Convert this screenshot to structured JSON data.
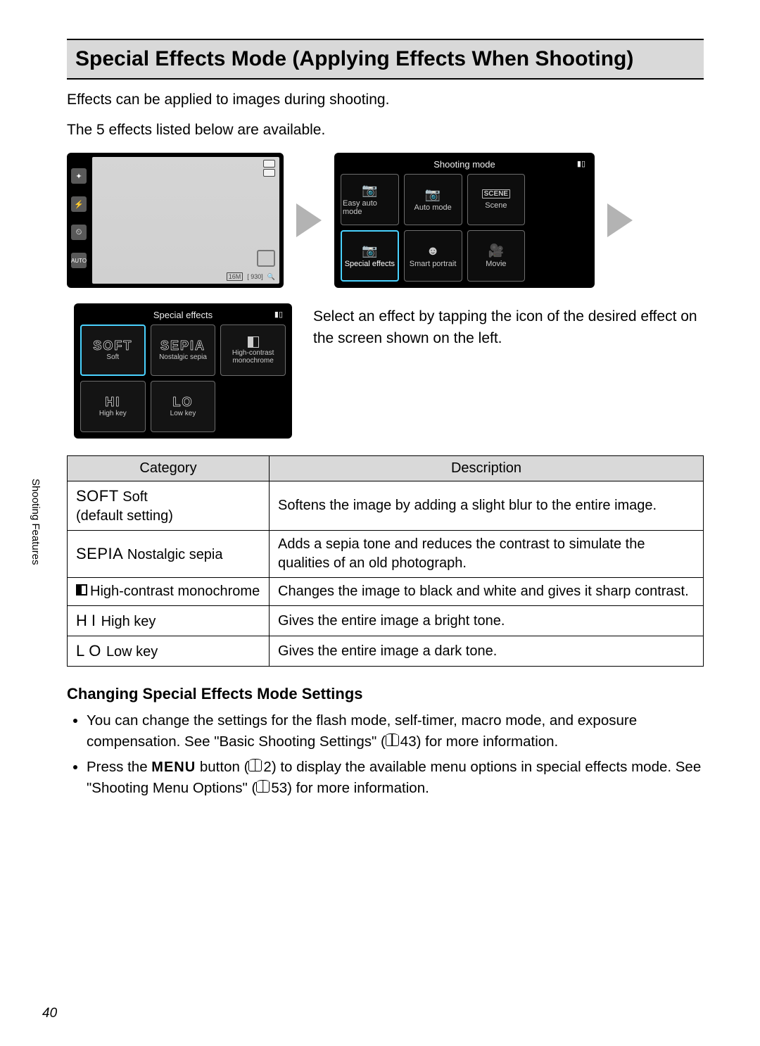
{
  "title": "Special Effects Mode (Applying Effects When Shooting)",
  "intro": {
    "line1": "Effects can be applied to images during shooting.",
    "line2": "The 5 effects listed below are available."
  },
  "screen1": {
    "badge_16m": "16M",
    "badge_count": "930"
  },
  "screen2": {
    "title": "Shooting mode",
    "cells": [
      {
        "label": "Easy auto mode"
      },
      {
        "label": "Auto mode"
      },
      {
        "label": "Scene"
      },
      {
        "label": "Special effects"
      },
      {
        "label": "Smart portrait"
      },
      {
        "label": "Movie"
      }
    ]
  },
  "screen3": {
    "title": "Special effects",
    "cells": [
      {
        "big": "SOFT",
        "small": "Soft"
      },
      {
        "big": "SEPIA",
        "small": "Nostalgic sepia"
      },
      {
        "big": "",
        "small": "High-contrast monochrome"
      },
      {
        "big": "HI",
        "small": "High key"
      },
      {
        "big": "LO",
        "small": "Low key"
      }
    ]
  },
  "rightText": "Select an effect by tapping the icon of the desired effect on the screen shown on the left.",
  "sidebar": "Shooting Features",
  "table": {
    "head": {
      "cat": "Category",
      "desc": "Description"
    },
    "rows": [
      {
        "icon": "SOFT",
        "name": "Soft",
        "note": "(default setting)",
        "desc": "Softens the image by adding a slight blur to the entire image."
      },
      {
        "icon": "SEPIA",
        "name": "Nostalgic sepia",
        "note": "",
        "desc": "Adds a sepia tone and reduces the contrast to simulate the qualities of an old photograph."
      },
      {
        "icon": "MONO",
        "name": "High-contrast monochrome",
        "note": "",
        "desc": "Changes the image to black and white and gives it sharp contrast."
      },
      {
        "icon": "HI",
        "name": "High key",
        "note": "",
        "desc": "Gives the entire image a bright tone."
      },
      {
        "icon": "LO",
        "name": "Low key",
        "note": "",
        "desc": "Gives the entire image a dark tone."
      }
    ]
  },
  "subsection": "Changing Special Effects Mode Settings",
  "bullets": {
    "b1a": "You can change the settings for the flash mode, self-timer, macro mode, and exposure compensation. See \"Basic Shooting Settings\" (",
    "b1ref": "43",
    "b1b": ") for more information.",
    "b2a": "Press the ",
    "b2menu": "MENU",
    "b2b": " button (",
    "b2ref1": "2",
    "b2c": ") to display the available menu options in special effects mode. See \"Shooting Menu Options\" (",
    "b2ref2": "53",
    "b2d": ") for more information."
  },
  "pageNumber": "40"
}
